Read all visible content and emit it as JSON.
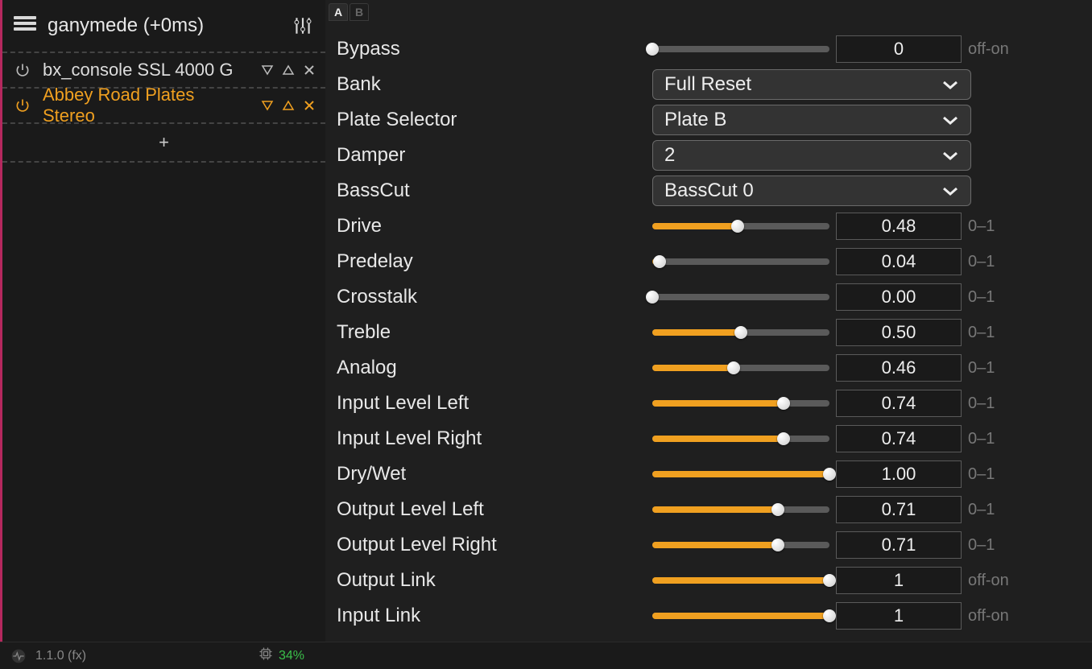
{
  "header": {
    "host_label": "ganymede (+0ms)"
  },
  "ab": {
    "tabs": [
      "A",
      "B"
    ],
    "active": 0
  },
  "plugins": [
    {
      "name": "bx_console SSL 4000 G",
      "selected": false
    },
    {
      "name": "Abbey Road Plates Stereo",
      "selected": true
    }
  ],
  "add_label": "+",
  "params": [
    {
      "kind": "slider",
      "label": "Bypass",
      "value_text": "0",
      "range": "off-on",
      "fill": 0.0,
      "colored": false
    },
    {
      "kind": "select",
      "label": "Bank",
      "selected": "Full Reset"
    },
    {
      "kind": "select",
      "label": "Plate Selector",
      "selected": "Plate B"
    },
    {
      "kind": "select",
      "label": "Damper",
      "selected": "2"
    },
    {
      "kind": "select",
      "label": "BassCut",
      "selected": "BassCut 0"
    },
    {
      "kind": "slider",
      "label": "Drive",
      "value_text": "0.48",
      "range": "0–1",
      "fill": 0.48,
      "colored": true
    },
    {
      "kind": "slider",
      "label": "Predelay",
      "value_text": "0.04",
      "range": "0–1",
      "fill": 0.04,
      "colored": true
    },
    {
      "kind": "slider",
      "label": "Crosstalk",
      "value_text": "0.00",
      "range": "0–1",
      "fill": 0.0,
      "colored": false
    },
    {
      "kind": "slider",
      "label": "Treble",
      "value_text": "0.50",
      "range": "0–1",
      "fill": 0.5,
      "colored": true
    },
    {
      "kind": "slider",
      "label": "Analog",
      "value_text": "0.46",
      "range": "0–1",
      "fill": 0.46,
      "colored": true
    },
    {
      "kind": "slider",
      "label": "Input Level Left",
      "value_text": "0.74",
      "range": "0–1",
      "fill": 0.74,
      "colored": true
    },
    {
      "kind": "slider",
      "label": "Input Level Right",
      "value_text": "0.74",
      "range": "0–1",
      "fill": 0.74,
      "colored": true
    },
    {
      "kind": "slider",
      "label": "Dry/Wet",
      "value_text": "1.00",
      "range": "0–1",
      "fill": 1.0,
      "colored": true
    },
    {
      "kind": "slider",
      "label": "Output Level Left",
      "value_text": "0.71",
      "range": "0–1",
      "fill": 0.71,
      "colored": true
    },
    {
      "kind": "slider",
      "label": "Output Level Right",
      "value_text": "0.71",
      "range": "0–1",
      "fill": 0.71,
      "colored": true
    },
    {
      "kind": "slider",
      "label": "Output Link",
      "value_text": "1",
      "range": "off-on",
      "fill": 1.0,
      "colored": true
    },
    {
      "kind": "slider",
      "label": "Input Link",
      "value_text": "1",
      "range": "off-on",
      "fill": 1.0,
      "colored": true
    }
  ],
  "footer": {
    "version": "1.1.0 (fx)",
    "cpu": "34%"
  }
}
